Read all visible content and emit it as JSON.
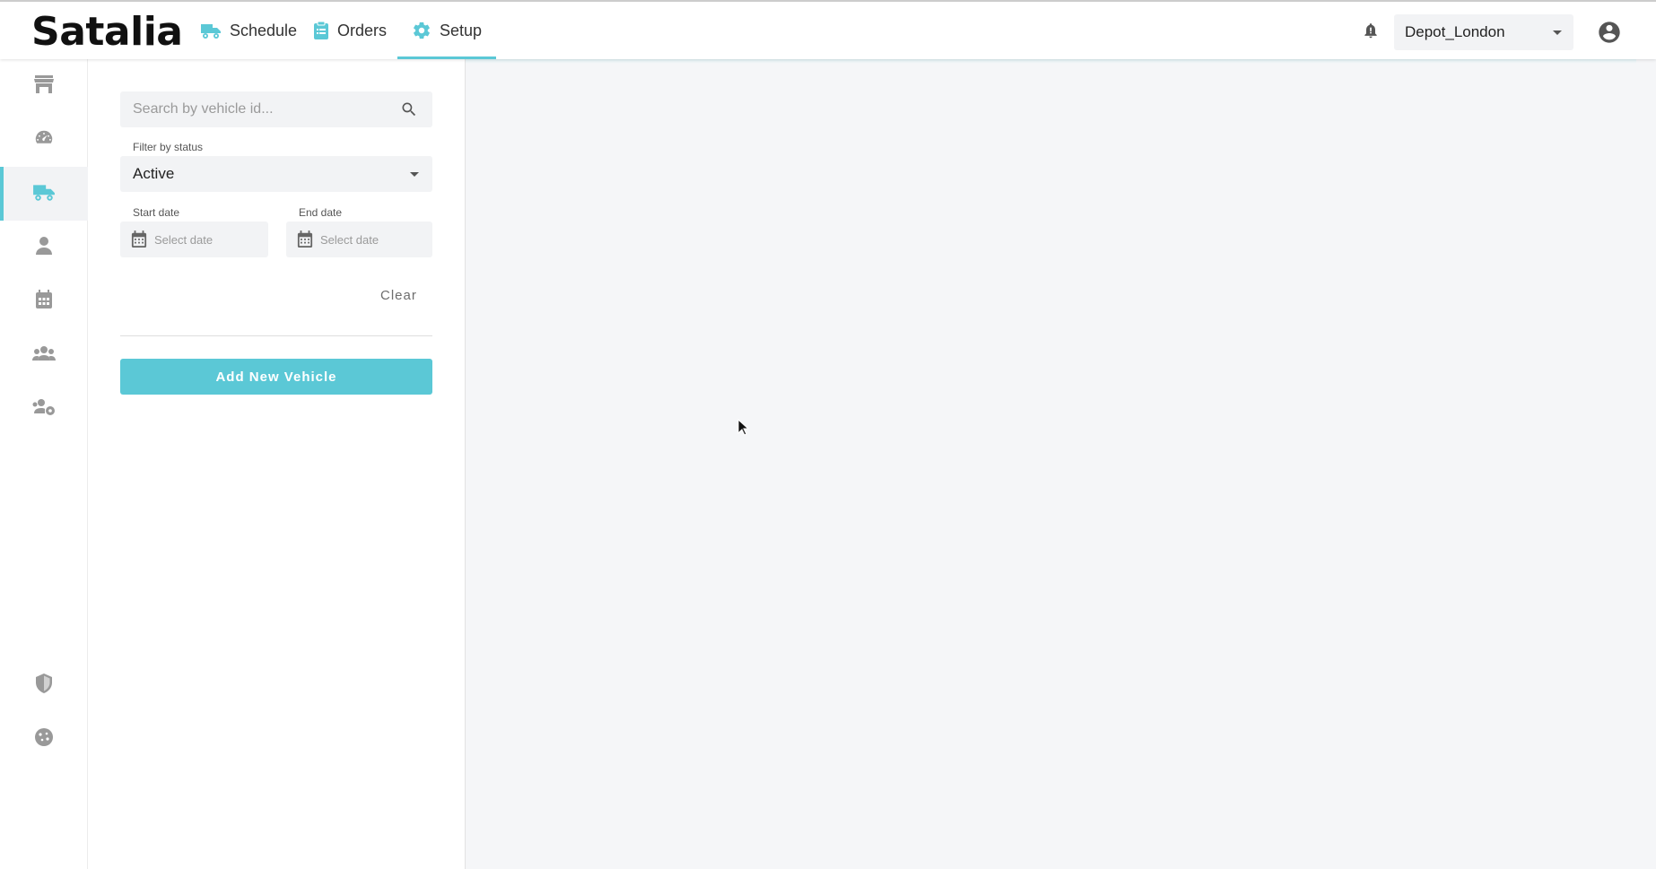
{
  "app": {
    "logo_text": "Satalia"
  },
  "nav": {
    "tabs": [
      {
        "label": "Schedule",
        "icon": "truck-icon"
      },
      {
        "label": "Orders",
        "icon": "clipboard-icon"
      },
      {
        "label": "Setup",
        "icon": "gear-icon",
        "active": true
      }
    ]
  },
  "header": {
    "depot_selected": "Depot_London",
    "notification_icon": "bell-icon",
    "account_icon": "account-circle-icon"
  },
  "sidebar": {
    "items": [
      {
        "icon": "store-icon"
      },
      {
        "icon": "speedometer-icon"
      },
      {
        "icon": "truck-icon",
        "active": true
      },
      {
        "icon": "person-icon"
      },
      {
        "icon": "calendar-icon"
      },
      {
        "icon": "group-icon"
      },
      {
        "icon": "group-settings-icon"
      },
      {
        "icon": "shield-icon"
      },
      {
        "icon": "cookie-icon"
      }
    ]
  },
  "filters": {
    "search_placeholder": "Search by vehicle id...",
    "status_label": "Filter by status",
    "status_value": "Active",
    "start_date_label": "Start date",
    "end_date_label": "End date",
    "date_placeholder": "Select date",
    "clear_label": "Clear",
    "add_button_label": "Add New Vehicle"
  },
  "colors": {
    "accent": "#5bc8d6",
    "content_bg": "#f5f6f8",
    "field_bg": "#f2f3f5"
  }
}
